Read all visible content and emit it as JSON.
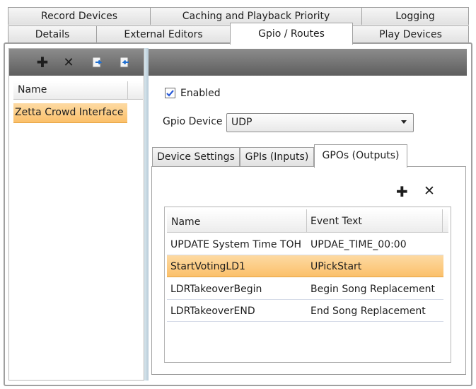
{
  "tabs_row1": [
    "Record Devices",
    "Caching and Playback Priority",
    "Logging"
  ],
  "tabs_row2": [
    "Details",
    "External Editors",
    "Gpio / Routes",
    "Play Devices"
  ],
  "left_toolbar": {
    "add_icon": "plus-icon",
    "remove_icon": "x-icon",
    "export_icon": "export-document-icon",
    "import_icon": "import-document-icon",
    "add_glyph": "✚",
    "remove_glyph": "✕"
  },
  "left_list": {
    "header": "Name",
    "items": [
      "Zetta Crowd Interface"
    ]
  },
  "enabled": {
    "label": "Enabled",
    "checked": true
  },
  "gpio_device": {
    "label": "Gpio Device",
    "value": "UDP"
  },
  "inner_tabs": [
    "Device Settings",
    "GPIs (Inputs)",
    "GPOs (Outputs)"
  ],
  "gpo_toolbar": {
    "add_glyph": "✚",
    "remove_glyph": "✕"
  },
  "gpo_table": {
    "columns": [
      "Name",
      "Event Text"
    ],
    "rows": [
      {
        "name": "UPDATE System Time TOH",
        "event": "UPDAE_TIME_00:00"
      },
      {
        "name": "StartVotingLD1",
        "event": "UPickStart"
      },
      {
        "name": "LDRTakeoverBegin",
        "event": "Begin Song Replacement"
      },
      {
        "name": "LDRTakeoverEND",
        "event": "End Song Replacement"
      }
    ]
  },
  "colors": {
    "selection": "#fbc06a",
    "panel_border": "#a0a0a0",
    "checkbox": "#2a5bd7"
  }
}
